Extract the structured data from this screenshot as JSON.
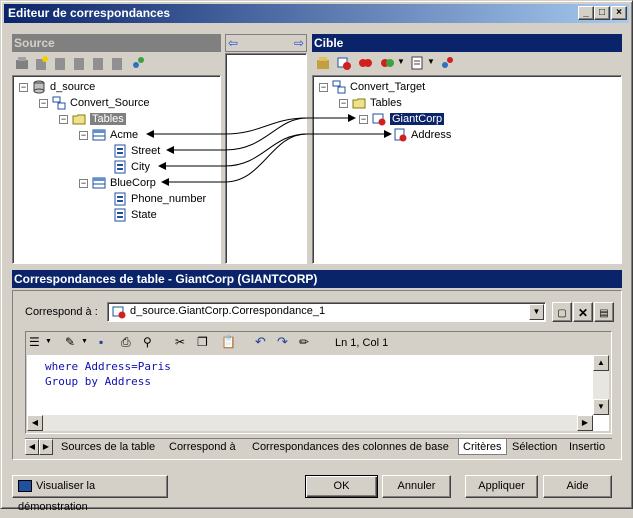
{
  "window": {
    "title": "Editeur de correspondances"
  },
  "source_panel": {
    "header": "Source",
    "tree": {
      "root": "d_source",
      "model": "Convert_Source",
      "folder": "Tables",
      "tables": [
        {
          "name": "Acme",
          "columns": [
            "Street",
            "City"
          ]
        },
        {
          "name": "BlueCorp",
          "columns": [
            "Phone_number",
            "State"
          ]
        }
      ]
    }
  },
  "target_panel": {
    "header": "Cible",
    "tree": {
      "root": "Convert_Target",
      "folder": "Tables",
      "table": "GiantCorp",
      "columns": [
        "Address"
      ]
    }
  },
  "mapping_section": {
    "header": "Correspondances de table - GiantCorp (GIANTCORP)",
    "correspond_label": "Correspond à :",
    "correspond_value": "d_source.GiantCorp.Correspondance_1",
    "cursor_position": "Ln 1, Col 1",
    "query_lines": [
      "where Address=Paris",
      "Group by Address"
    ],
    "tabs": [
      "Sources de la table",
      "Correspond à",
      "Correspondances des colonnes de base",
      "Critères",
      "Sélection",
      "Insertio"
    ],
    "active_tab": "Critères"
  },
  "buttons": {
    "demo": "Visualiser la démonstration",
    "ok": "OK",
    "cancel": "Annuler",
    "apply": "Appliquer",
    "help": "Aide"
  }
}
